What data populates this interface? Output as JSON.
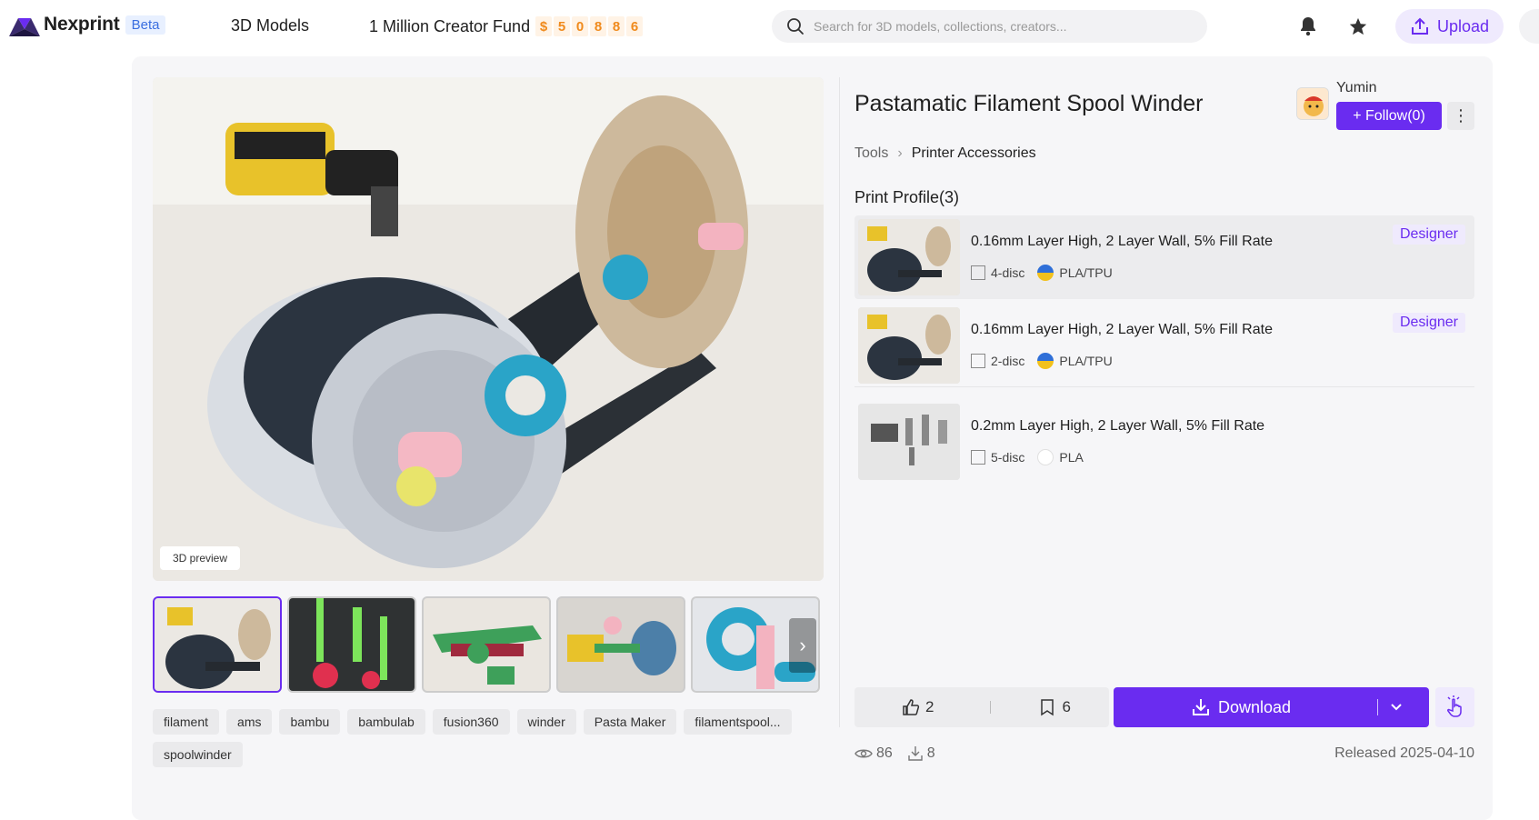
{
  "header": {
    "logo_text": "Nexprint",
    "beta_label": "Beta",
    "nav_3d_models": "3D Models",
    "fund_label": "1 Million Creator Fund",
    "fund_digits": [
      "$",
      "5",
      "0",
      "8",
      "8",
      "6"
    ],
    "search_placeholder": "Search for 3D models, collections, creators...",
    "upload_label": "Upload"
  },
  "model": {
    "title": "Pastamatic Filament Spool Winder",
    "author": "Yumin",
    "follow_label": "+ Follow(0)",
    "breadcrumb": [
      "Tools",
      "Printer Accessories"
    ],
    "preview_badge": "3D preview",
    "tags": [
      "filament",
      "ams",
      "bambu",
      "bambulab",
      "fusion360",
      "winder",
      "Pasta Maker",
      "filamentspool...",
      "spoolwinder"
    ]
  },
  "profiles": {
    "heading": "Print Profile(3)",
    "items": [
      {
        "title": "0.16mm Layer High, 2 Layer Wall, 5% Fill Rate",
        "plates": "4-disc",
        "material": "PLA/TPU",
        "badge": "Designer"
      },
      {
        "title": "0.16mm Layer High, 2 Layer Wall, 5% Fill Rate",
        "plates": "2-disc",
        "material": "PLA/TPU",
        "badge": "Designer"
      },
      {
        "title": "0.2mm Layer High, 2 Layer Wall, 5% Fill Rate",
        "plates": "5-disc",
        "material": "PLA",
        "badge": ""
      }
    ]
  },
  "actions": {
    "likes": "2",
    "bookmarks": "6",
    "download_label": "Download"
  },
  "stats": {
    "views": "86",
    "downloads": "8",
    "released": "Released 2025-04-10"
  },
  "colors": {
    "accent": "#6a2cf0",
    "fund_digit": "#f08a1c"
  }
}
